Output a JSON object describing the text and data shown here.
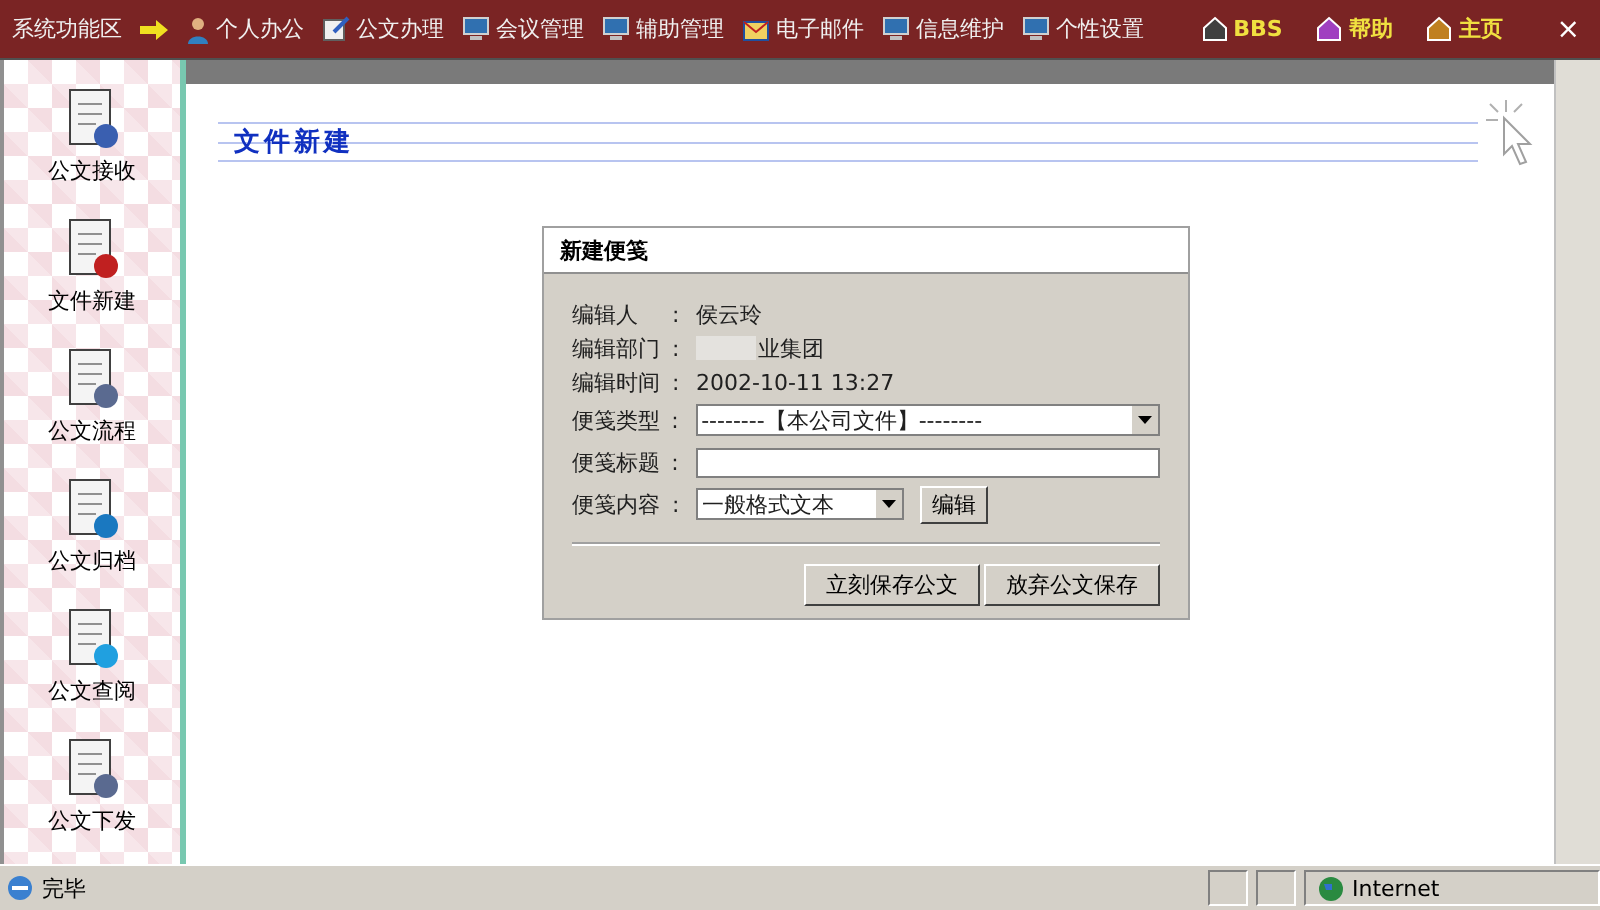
{
  "top_menu": {
    "title": "系统功能区",
    "items": [
      {
        "label": "个人办公"
      },
      {
        "label": "公文办理"
      },
      {
        "label": "会议管理"
      },
      {
        "label": "辅助管理"
      },
      {
        "label": "电子邮件"
      },
      {
        "label": "信息维护"
      },
      {
        "label": "个性设置"
      }
    ],
    "right_items": [
      {
        "label": "BBS"
      },
      {
        "label": "帮助"
      },
      {
        "label": "主页"
      }
    ],
    "close": "×"
  },
  "sidebar": {
    "items": [
      {
        "label": "公文接收"
      },
      {
        "label": "文件新建"
      },
      {
        "label": "公文流程"
      },
      {
        "label": "公文归档"
      },
      {
        "label": "公文查阅"
      },
      {
        "label": "公文下发"
      }
    ]
  },
  "page_title": "文件新建",
  "dialog": {
    "title": "新建便笺",
    "fields": [
      {
        "kind": "text",
        "label": "编辑人",
        "separator": ":",
        "value": "侯云玲"
      },
      {
        "kind": "redacted",
        "label": "编辑部门",
        "separator": ":",
        "value": "业集团"
      },
      {
        "kind": "text",
        "label": "编辑时间",
        "separator": ":",
        "value": "2002-10-11 13:27"
      },
      {
        "kind": "select",
        "label": "便笺类型",
        "separator": ":",
        "value": "--------【本公司文件】--------"
      },
      {
        "kind": "input",
        "label": "便笺标题",
        "separator": ":"
      },
      {
        "kind": "select_button",
        "label": "便笺内容",
        "separator": ":",
        "value": "一般格式文本",
        "button": "编辑"
      }
    ],
    "buttons": [
      "立刻保存公文",
      "放弃公文保存"
    ]
  },
  "status_bar": {
    "text": "完毕",
    "zone": "Internet"
  }
}
